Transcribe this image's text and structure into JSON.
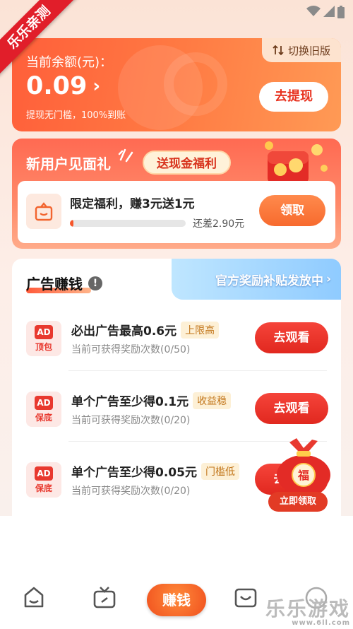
{
  "ribbon": {
    "text": "乐乐亲测"
  },
  "balance": {
    "label": "当前余额(元)：",
    "value": "0.09",
    "note": "提现无门槛，100%到账",
    "withdraw_button": "去提现",
    "switch_old": "切换旧版"
  },
  "new_user": {
    "title": "新用户见面礼",
    "tag": "送现金福利",
    "offer_title": "限定福利，赚3元送1元",
    "progress": 0.03,
    "remaining": "还差2.90元",
    "claim_button": "领取"
  },
  "ad_section": {
    "title": "广告赚钱",
    "info_icon": "!",
    "banner": "官方奖励补贴发放中",
    "rows": [
      {
        "badge": "AD",
        "badge_sub": "顶包",
        "title": "必出广告最高0.6元",
        "tag": "上限高",
        "sub": "当前可获得奖励次数(0/50)",
        "button": "去观看"
      },
      {
        "badge": "AD",
        "badge_sub": "保底",
        "title": "单个广告至少得0.1元",
        "tag": "收益稳",
        "sub": "当前可获得奖励次数(0/20)",
        "button": "去观看"
      },
      {
        "badge": "AD",
        "badge_sub": "保底",
        "title": "单个广告至少得0.05元",
        "tag": "门槛低",
        "sub": "当前可获得奖励次数(0/20)",
        "button": "去观看"
      }
    ]
  },
  "floating_bag": {
    "char": "福",
    "pill": "立即领取"
  },
  "nav": {
    "center_label": "赚钱"
  },
  "watermark": {
    "text": "乐乐游戏",
    "url": "www.6ll.com"
  },
  "colors": {
    "accent": "#ff5f3a",
    "button_red": "#e1281f",
    "claim_orange": "#f76a2e"
  }
}
